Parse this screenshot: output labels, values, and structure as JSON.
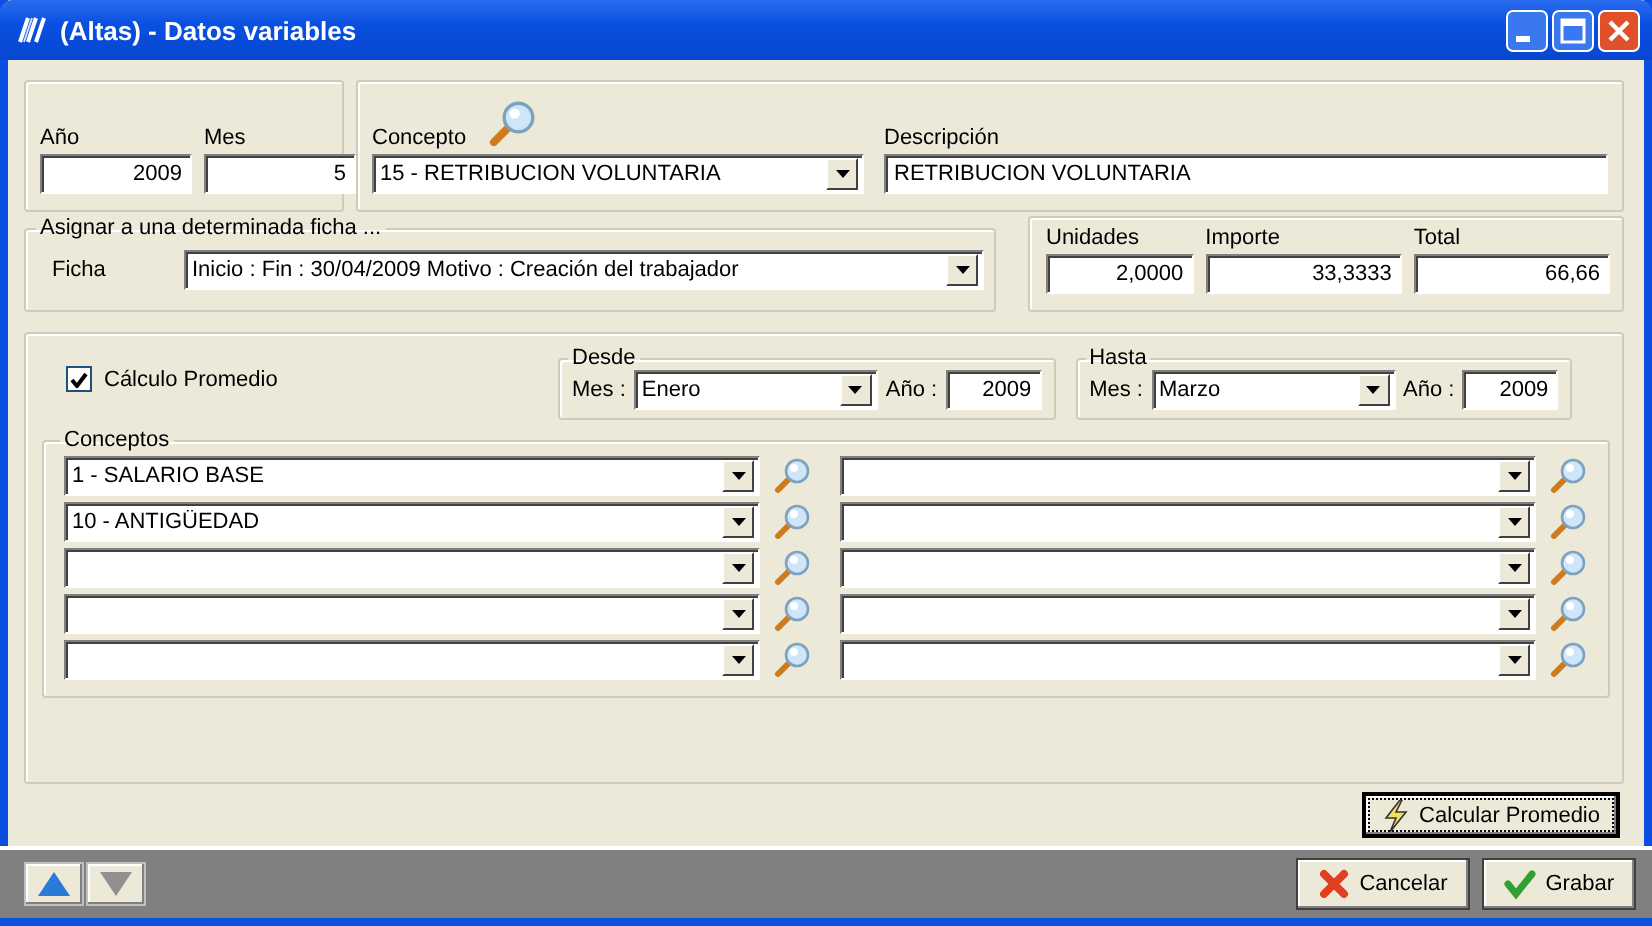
{
  "window": {
    "title": "(Altas) - Datos variables"
  },
  "period": {
    "year_label": "Año",
    "year": "2009",
    "month_label": "Mes",
    "month": "5"
  },
  "concept": {
    "label": "Concepto",
    "value": "15 - RETRIBUCION VOLUNTARIA",
    "description_label": "Descripción",
    "description": "RETRIBUCION VOLUNTARIA"
  },
  "assign": {
    "legend": "Asignar a una determinada ficha ...",
    "label": "Ficha",
    "value": "Inicio :  Fin : 30/04/2009 Motivo : Creación del trabajador"
  },
  "amounts": [
    {
      "label": "Unidades",
      "value": "2,0000"
    },
    {
      "label": "Importe",
      "value": "33,3333"
    },
    {
      "label": "Total",
      "value": "66,66"
    }
  ],
  "average": {
    "checkbox": {
      "label": "Cálculo Promedio",
      "checked": true
    },
    "from": {
      "legend": "Desde",
      "month_label": "Mes :",
      "month": "Enero",
      "year_label": "Año :",
      "year": "2009"
    },
    "to": {
      "legend": "Hasta",
      "month_label": "Mes :",
      "month": "Marzo",
      "year_label": "Año :",
      "year": "2009"
    },
    "concepts": {
      "legend": "Conceptos",
      "left": [
        {
          "kind": "combo",
          "value": "1 - SALARIO BASE"
        },
        {
          "kind": "combo",
          "value": "10 - ANTIGÜEDAD"
        },
        {
          "kind": "combo"
        },
        {
          "kind": "combo"
        },
        {
          "kind": "combo"
        }
      ],
      "right": [
        {
          "kind": "combo"
        },
        {
          "kind": "combo"
        },
        {
          "kind": "combo"
        },
        {
          "kind": "combo"
        },
        {
          "kind": "combo"
        }
      ]
    },
    "calc_button": "Calcular Promedio"
  },
  "footer_buttons": [
    {
      "kind": "cancel",
      "label": "Cancelar"
    },
    {
      "kind": "save",
      "label": "Grabar"
    }
  ]
}
